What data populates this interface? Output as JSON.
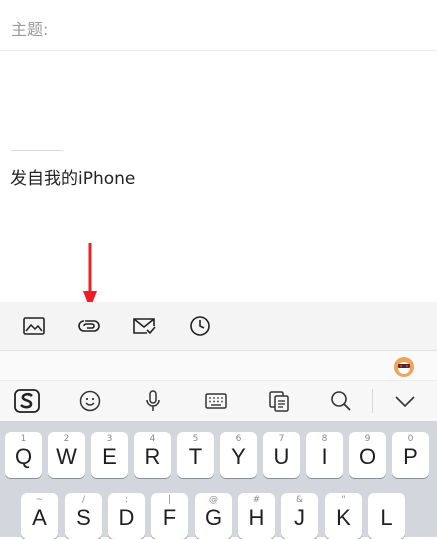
{
  "compose": {
    "subject_label": "主题:",
    "signature": "发自我的iPhone"
  },
  "toolbar": {
    "items": [
      {
        "name": "image-icon"
      },
      {
        "name": "attachment-icon"
      },
      {
        "name": "mail-check-icon"
      },
      {
        "name": "clock-icon"
      }
    ]
  },
  "ime_toolbar": {
    "items": [
      {
        "name": "sogou-logo-icon"
      },
      {
        "name": "emoji-icon"
      },
      {
        "name": "microphone-icon"
      },
      {
        "name": "keyboard-icon"
      },
      {
        "name": "clipboard-icon"
      },
      {
        "name": "search-icon"
      },
      {
        "name": "collapse-icon"
      }
    ]
  },
  "keyboard": {
    "row1": [
      {
        "key": "Q",
        "hint": "1"
      },
      {
        "key": "W",
        "hint": "2"
      },
      {
        "key": "E",
        "hint": "3"
      },
      {
        "key": "R",
        "hint": "4"
      },
      {
        "key": "T",
        "hint": "5"
      },
      {
        "key": "Y",
        "hint": "6"
      },
      {
        "key": "U",
        "hint": "7"
      },
      {
        "key": "I",
        "hint": "8"
      },
      {
        "key": "O",
        "hint": "9"
      },
      {
        "key": "P",
        "hint": "0"
      }
    ],
    "row2": [
      {
        "key": "A",
        "hint": "~"
      },
      {
        "key": "S",
        "hint": "/"
      },
      {
        "key": "D",
        "hint": ":"
      },
      {
        "key": "F",
        "hint": "|"
      },
      {
        "key": "G",
        "hint": "@"
      },
      {
        "key": "H",
        "hint": "#"
      },
      {
        "key": "J",
        "hint": "&"
      },
      {
        "key": "K",
        "hint": "\""
      },
      {
        "key": "L",
        "hint": ""
      }
    ]
  },
  "colors": {
    "annotation_arrow": "#e8202a",
    "keyboard_bg": "#d3d6dc",
    "toolbar_bg": "#f4f4f4"
  }
}
